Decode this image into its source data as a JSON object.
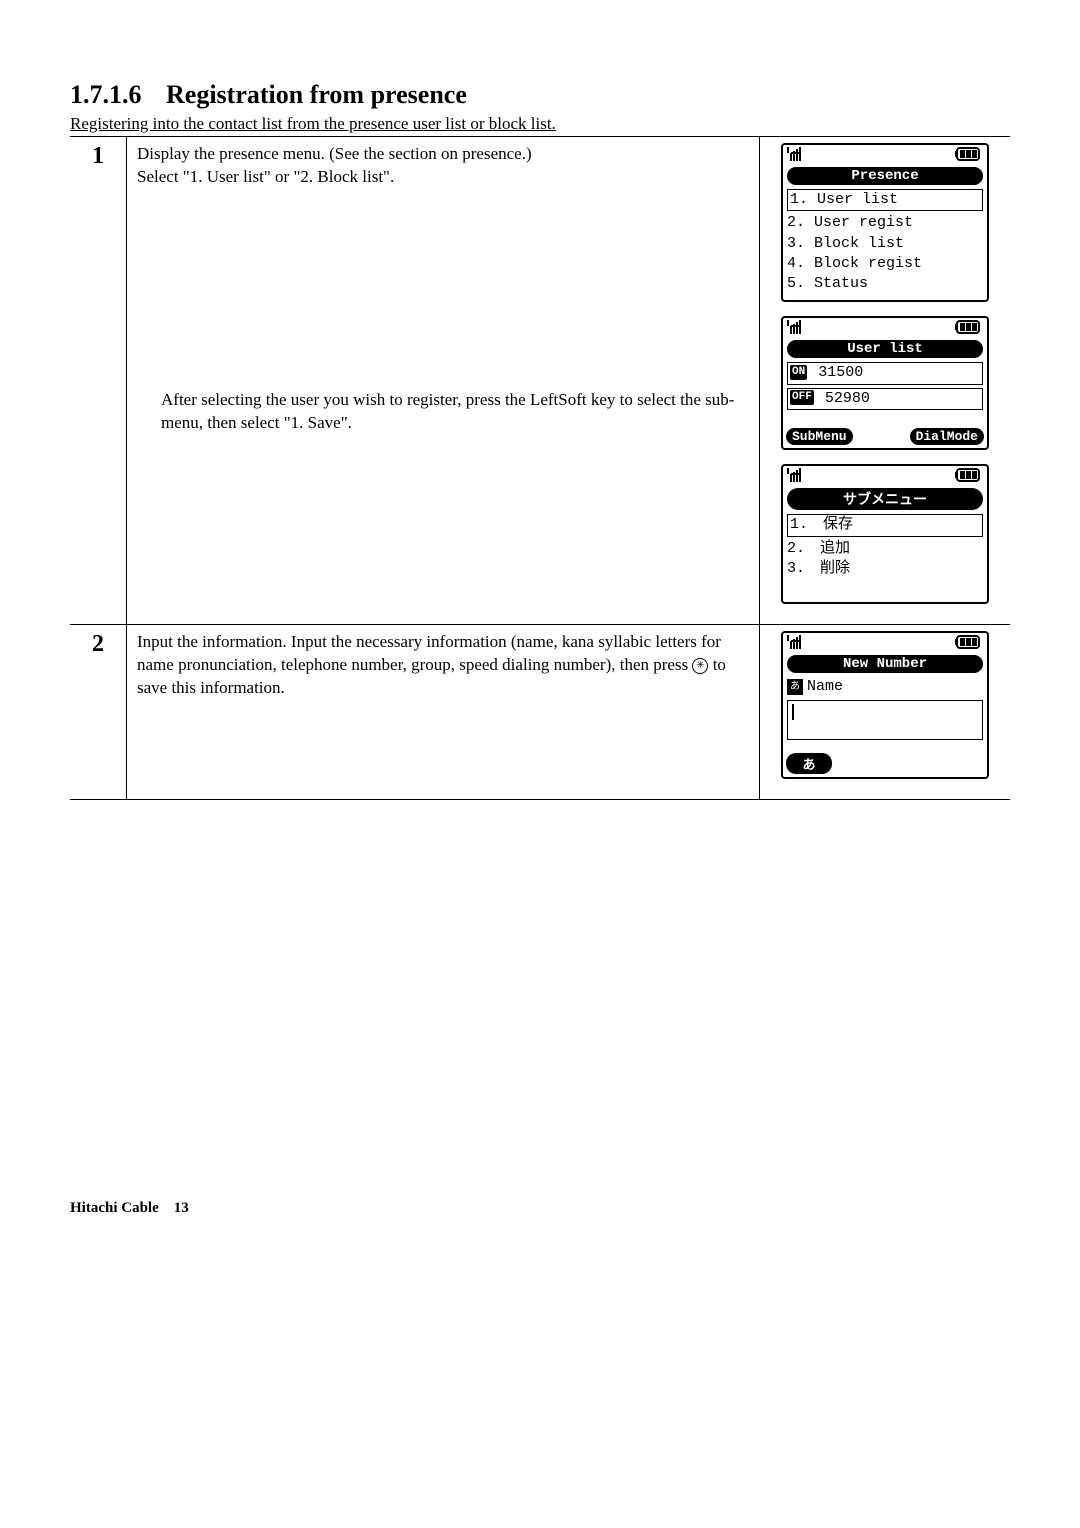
{
  "heading": {
    "number": "1.7.1.6",
    "title": "Registration from presence"
  },
  "subtitle": "Registering into the contact list from the presence user list or block list.",
  "steps": [
    {
      "num": "1",
      "para1": "Display the presence menu. (See the section on presence.)",
      "para2": "Select \"1. User list\" or \"2. Block list\".",
      "para3a": "After selecting the user you wish to register, press the LeftSoft key to select the sub-menu, then select \"1. Save\"."
    },
    {
      "num": "2",
      "para": "Input the information. Input the necessary information (name, kana syllabic letters for name pronunciation, telephone number, group, speed dialing number), then press ",
      "para_tail": " to save this information."
    }
  ],
  "screens": {
    "presence": {
      "title": "Presence",
      "items": [
        "1. User list",
        "2. User regist",
        "3. Block list",
        "4. Block regist",
        "5. Status"
      ]
    },
    "userlist": {
      "title": "User list",
      "rows": [
        {
          "badge": "ON",
          "num": "31500"
        },
        {
          "badge": "OFF",
          "num": "52980"
        }
      ],
      "soft_left": "SubMenu",
      "soft_right": "DialMode"
    },
    "submenu": {
      "title": "サブメニュー",
      "items": [
        "1.　保存",
        "2.　追加",
        "3.　削除"
      ]
    },
    "newnumber": {
      "title": "New Number",
      "label": "Name",
      "soft_left": "あ"
    }
  },
  "footer": {
    "left": "Hitachi Cable",
    "page": "13"
  }
}
